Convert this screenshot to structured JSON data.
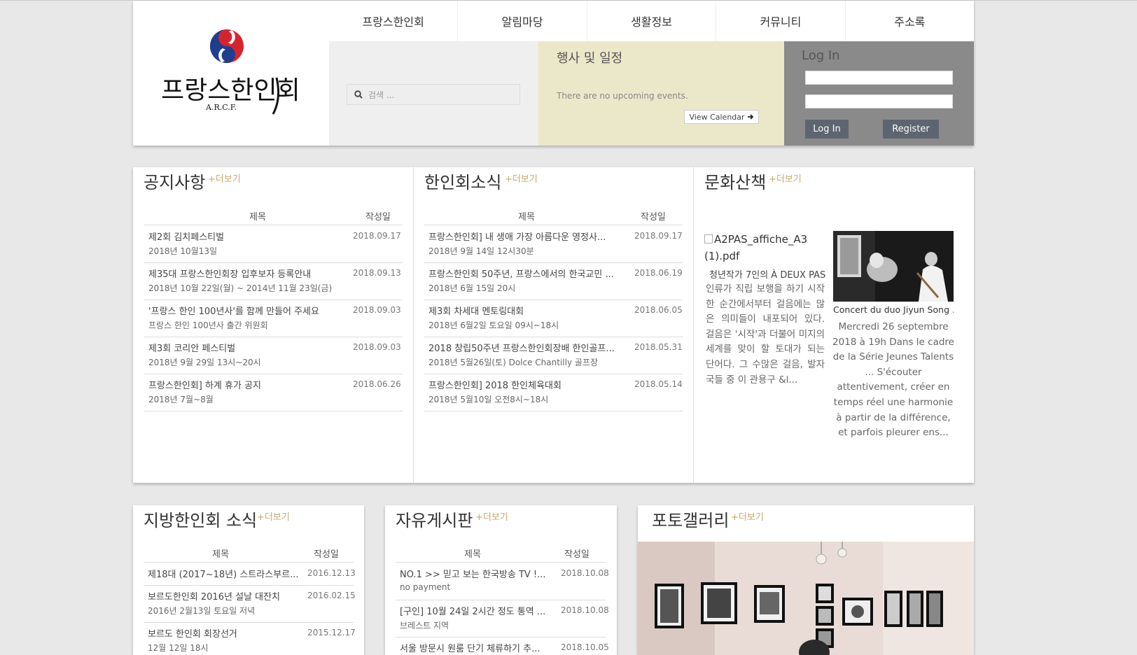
{
  "nav": {
    "items": [
      "프랑스한인회",
      "알림마당",
      "생활정보",
      "커뮤니티",
      "주소록"
    ]
  },
  "logo": {
    "text": "프랑스한인회",
    "sub": "A.R.C.F."
  },
  "search": {
    "placeholder": "검색 ..."
  },
  "events": {
    "title": "행사 및 일정",
    "empty": "There are no upcoming events.",
    "calendar_button": "View Calendar"
  },
  "login": {
    "title": "Log In",
    "login_button": "Log In",
    "register_button": "Register"
  },
  "more_label": "+더보기",
  "table_head": {
    "title": "제목",
    "date": "작성일"
  },
  "notice": {
    "title": "공지사항",
    "rows": [
      {
        "title": "제2회 김치페스티벌",
        "sub": "2018년 10월13일",
        "date": "2018.09.17"
      },
      {
        "title": "제35대 프랑스한인회장 입후보자 등록안내",
        "sub": "2018년 10월 22일(월) ~ 2014년 11월 23일(금)",
        "date": "2018.09.13"
      },
      {
        "title": "'프랑스 한인 100년사'를 함께 만들어 주세요",
        "sub": "프랑스 한인 100년사 출간 위원회",
        "date": "2018.09.03"
      },
      {
        "title": "제3회 코리안 페스티벌",
        "sub": "2018년 9월 29일 13시~20시",
        "date": "2018.09.03"
      },
      {
        "title": "프랑스한인회] 하계 휴가 공지",
        "sub": "2018년 7월~8월",
        "date": "2018.06.26"
      }
    ]
  },
  "news": {
    "title": "한인회소식",
    "rows": [
      {
        "title": "프랑스한인회] 내 생애 가장 아름다운 영정사...",
        "sub": "2018년 9월 14일 12시30분",
        "date": "2018.09.17"
      },
      {
        "title": "프랑스한인회 50주년, 프랑스에서의 한국교민 ...",
        "sub": "2018년 6월 15일 20시",
        "date": "2018.06.19"
      },
      {
        "title": "제3회 차세대 멘토링대회",
        "sub": "2018년 6월2일 토요일 09시~18시",
        "date": "2018.06.05"
      },
      {
        "title": "2018 창립50주년 프랑스한인회장배 한인골프...",
        "sub": "2018년 5월26일(토) Dolce Chantilly 골프장",
        "date": "2018.05.31"
      },
      {
        "title": "프랑스한인회] 2018 한인체육대회",
        "sub": "2018년 5월10일 오전8시~18시",
        "date": "2018.05.14"
      }
    ]
  },
  "culture": {
    "title": "문화산책",
    "left_alt": "A2PAS_affiche_A3 (1).pdf",
    "left_heading": "청년작가 7인의 À DEUX PAS",
    "left_text": "인류가 직립 보행을 하기 시작한 순간에서부터 걸음에는 많은 의미들이 내포되어 있다. 걸음은 '시작'과 더불어 미지의 세계를 맞이 할 토대가 되는 단어다. 그 수많은 걸음, 발자국들 중 이 관용구 &l...",
    "right_heading": "Concert du duo Jiyun Song ...",
    "right_text": "Mercredi 26 septembre 2018 à 19h Dans le cadre de la Série Jeunes Talents ... S'écouter attentivement, créer en temps réel une harmonie à partir de la différence, et parfois pleurer ens..."
  },
  "regional": {
    "title": "지방한인회 소식",
    "rows": [
      {
        "title": "제18대 (2017~18년) 스트라스부르...",
        "sub": "",
        "date": "2016.12.13"
      },
      {
        "title": "보르도한인회 2016년 설날 대잔치",
        "sub": "2016년 2월13일 토요일 저녁",
        "date": "2016.02.15"
      },
      {
        "title": "보르도 한인회 회장선거",
        "sub": "12월 12일 18시",
        "date": "2015.12.17"
      }
    ]
  },
  "board": {
    "title": "자유게시판",
    "rows": [
      {
        "title": "NO.1 >> 믿고 보는 한국방송 TV !...",
        "sub": "no payment",
        "date": "2018.10.08"
      },
      {
        "title": "[구인] 10월 24일 2시간 정도 통역 ...",
        "sub": "브레스트 지역",
        "date": "2018.10.08"
      },
      {
        "title": "서울 방문시 원룸 단기 체류하기 추...",
        "sub": "",
        "date": "2018.10.05"
      }
    ]
  },
  "gallery": {
    "title": "포토갤러리"
  }
}
